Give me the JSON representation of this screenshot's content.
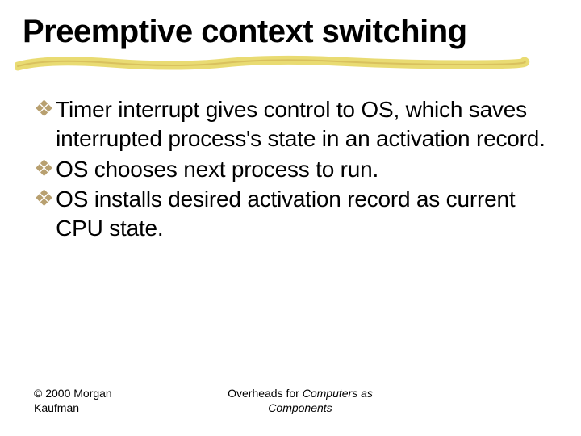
{
  "title": "Preemptive context switching",
  "bullets": [
    "Timer interrupt gives control to OS, which saves interrupted process's state in an activation record.",
    "OS chooses next process to run.",
    "OS installs desired activation record as current CPU state."
  ],
  "footer": {
    "left_line1": "© 2000 Morgan",
    "left_line2": "Kaufman",
    "center_plain": "Overheads for ",
    "center_italic1": "Computers as",
    "center_italic2": "Components"
  },
  "bullet_glyph": "❖"
}
